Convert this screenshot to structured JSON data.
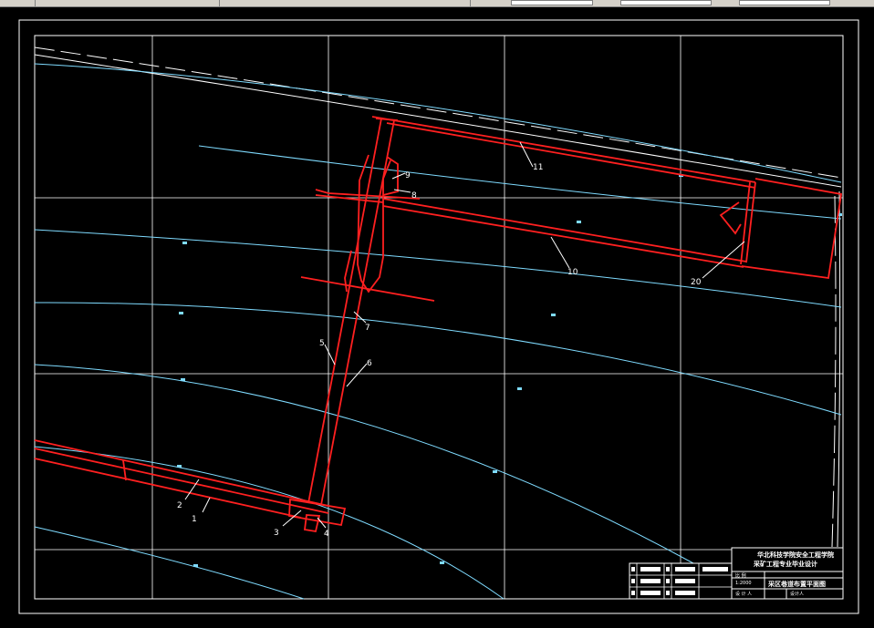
{
  "toolbar": {
    "buttons": [
      "undo-icon",
      "redo-icon",
      "pan-icon",
      "zoom-icon",
      "properties-icon",
      "layer-icon",
      "text-style-icon",
      "dimension-style-icon",
      "table-icon",
      "help-icon"
    ],
    "colors": {
      "face": "#d4d0c8"
    }
  },
  "drawing": {
    "colors": {
      "background": "#000000",
      "frame": "#ffffff",
      "grid": "#ffffff",
      "contour": "#7fdbff",
      "roadway": "#ff2020"
    },
    "labels": {
      "l1": "1",
      "l2": "2",
      "l3": "3",
      "l4": "4",
      "l5": "5",
      "l6": "6",
      "l7": "7",
      "l8": "8",
      "l9": "9",
      "l10": "10",
      "l11": "11",
      "l20": "20"
    },
    "title_block": {
      "school_line1": "华北科技学院安全工程学院",
      "school_line2": "采矿工程专业毕业设计",
      "scale_label": "比 例",
      "scale": "1:2000",
      "drawing_name": "采区巷道布置平面图",
      "designer_label": "设 计 人",
      "designer": "设计人"
    }
  }
}
